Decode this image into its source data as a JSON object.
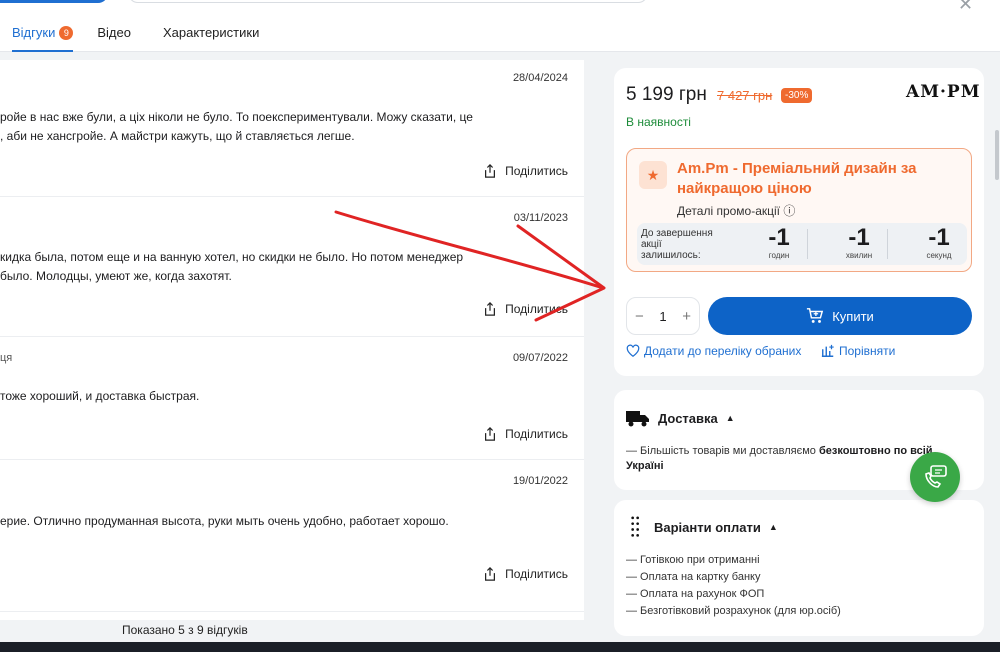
{
  "tabs": [
    {
      "label": "Відгуки",
      "badge": "9"
    },
    {
      "label": "Відео"
    },
    {
      "label": "Характеристики"
    }
  ],
  "reviews": [
    {
      "date": "28/04/2024",
      "author": "",
      "text": [
        "ройе в нас вже були, а ціх ніколи не було. То поекспериментували. Можу сказати, це",
        ", аби не хансгройе. А майстри кажуть, що й ставляється легше."
      ],
      "share": "Поділитись"
    },
    {
      "date": "03/11/2023",
      "author": "",
      "text": [
        "кидка была, потом еще и на ванную хотел, но скидки не было. Но потом менеджер",
        "было. Молодцы, умеют же, когда захотят."
      ],
      "share": "Поділитись"
    },
    {
      "date": "09/07/2022",
      "author": "ця",
      "text": [
        "тоже хороший, и доставка быстрая."
      ],
      "share": "Поділитись"
    },
    {
      "date": "19/01/2022",
      "author": "",
      "text": [
        "ерие. Отлично продуманная высота, руки мыть очень удобно, работает хорошо."
      ],
      "share": "Поділитись"
    }
  ],
  "shown_text": "Показано 5 з 9 відгуків",
  "product": {
    "price": "5 199 грн",
    "old_price": "7 427 грн",
    "discount": "-30%",
    "brand_logo": "AM·PM",
    "stock": "В наявності"
  },
  "promo": {
    "title": "Am.Pm - Преміальний дизайн за найкращою ціною",
    "details": "Деталі промо-акції",
    "countdown_label": "До завершення акції залишилось:",
    "countdown": [
      {
        "value": "-1",
        "unit": "годин"
      },
      {
        "value": "-1",
        "unit": "хвилин"
      },
      {
        "value": "-1",
        "unit": "секунд"
      }
    ]
  },
  "cart": {
    "quantity": "1",
    "minus": "−",
    "plus": "+",
    "buy_label": "Купити",
    "wishlist_label": "Додати до переліку обраних",
    "compare_label": "Порівняти"
  },
  "delivery": {
    "title": "Доставка",
    "text_prefix": "— Більшість товарів ми доставляємо ",
    "text_bold": "безкоштовно по всій Україні"
  },
  "payment": {
    "title": "Варіанти оплати",
    "options": [
      "— Готівкою при отриманні",
      "— Оплата на картку банку",
      "— Оплата на рахунок ФОП",
      "— Безготівковий розрахунок (для юр.осіб)"
    ]
  },
  "colors": {
    "accent": "#1f6fd1",
    "promo_orange": "#ef6a2f",
    "in_stock_green": "#1e8c3a",
    "annotation_red": "#e02424",
    "chat_green": "#3aa847"
  }
}
